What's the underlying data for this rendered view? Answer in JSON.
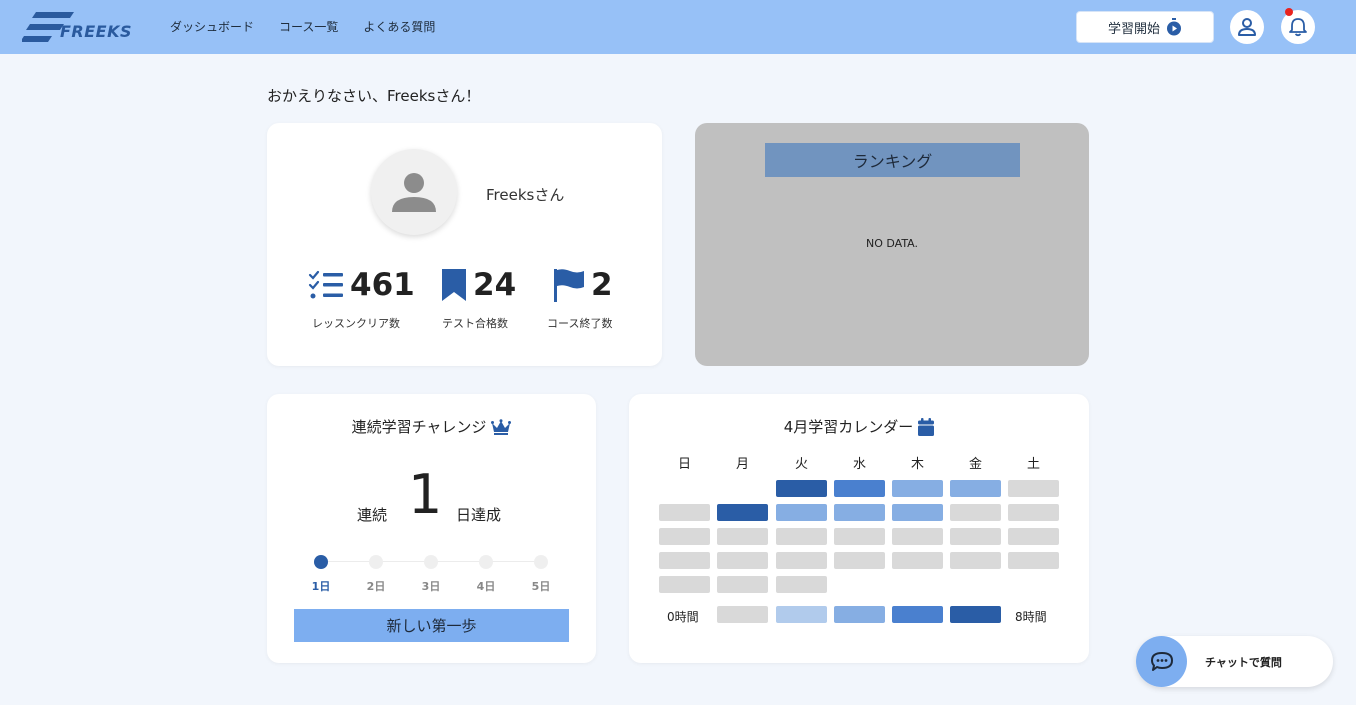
{
  "header": {
    "logo_text": "FREEKS",
    "nav": [
      "ダッシュボード",
      "コース一覧",
      "よくある質問"
    ],
    "start_label": "学習開始"
  },
  "welcome": "おかえりなさい、Freeksさん！",
  "profile": {
    "name": "Freeksさん",
    "stats": [
      {
        "value": "461",
        "label": "レッスンクリア数",
        "icon": "checklist-icon"
      },
      {
        "value": "24",
        "label": "テスト合格数",
        "icon": "bookmark-icon"
      },
      {
        "value": "2",
        "label": "コース終了数",
        "icon": "flag-icon"
      }
    ]
  },
  "ranking": {
    "title": "ランキング",
    "empty": "NO DATA."
  },
  "streak": {
    "title": "連続学習チャレンジ",
    "prefix": "連続",
    "count": "1",
    "suffix": "日達成",
    "days": [
      "1日",
      "2日",
      "3日",
      "4日",
      "5日"
    ],
    "achieved_days": 1,
    "button_label": "新しい第一歩"
  },
  "calendar": {
    "title": "4月学習カレンダー",
    "weekdays": [
      "日",
      "月",
      "火",
      "水",
      "木",
      "金",
      "土"
    ],
    "first_weekday_index": 2,
    "levels": [
      4,
      3,
      2,
      2,
      0,
      0,
      4,
      2,
      2,
      2,
      0,
      0,
      0,
      0,
      0,
      0,
      0,
      0,
      0,
      0,
      0,
      0,
      0,
      0,
      0,
      0,
      0,
      0,
      0
    ],
    "legend_min": "0時間",
    "legend_max": "8時間",
    "level_colors": [
      "#d9d9d9",
      "#b1cbec",
      "#86aee3",
      "#4a80cf",
      "#2a5da6"
    ]
  },
  "chat": {
    "label": "チャットで質問"
  }
}
